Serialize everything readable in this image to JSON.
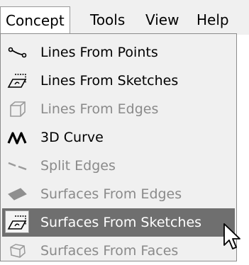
{
  "menubar": {
    "items": [
      {
        "label": "Concept",
        "active": true
      },
      {
        "label": "Tools"
      },
      {
        "label": "View"
      },
      {
        "label": "Help"
      }
    ]
  },
  "menu": {
    "items": [
      {
        "label": "Lines From Points",
        "icon": "line-points-icon",
        "enabled": true
      },
      {
        "label": "Lines From Sketches",
        "icon": "sketch-lines-icon",
        "enabled": true
      },
      {
        "label": "Lines From Edges",
        "icon": "cube-edges-icon",
        "enabled": false
      },
      {
        "label": "3D Curve",
        "icon": "curve-icon",
        "enabled": true
      },
      {
        "label": "Split Edges",
        "icon": "split-edges-icon",
        "enabled": false
      },
      {
        "label": "Surfaces From Edges",
        "icon": "surface-edges-icon",
        "enabled": false
      },
      {
        "label": "Surfaces From Sketches",
        "icon": "surface-sketch-icon",
        "enabled": true,
        "highlighted": true
      },
      {
        "label": "Surfaces From Faces",
        "icon": "surface-faces-icon",
        "enabled": false
      }
    ]
  },
  "colors": {
    "menu_bg": "#f0f0f0",
    "highlight_bg": "#6f6f6f",
    "disabled_text": "#8a8a8a"
  }
}
